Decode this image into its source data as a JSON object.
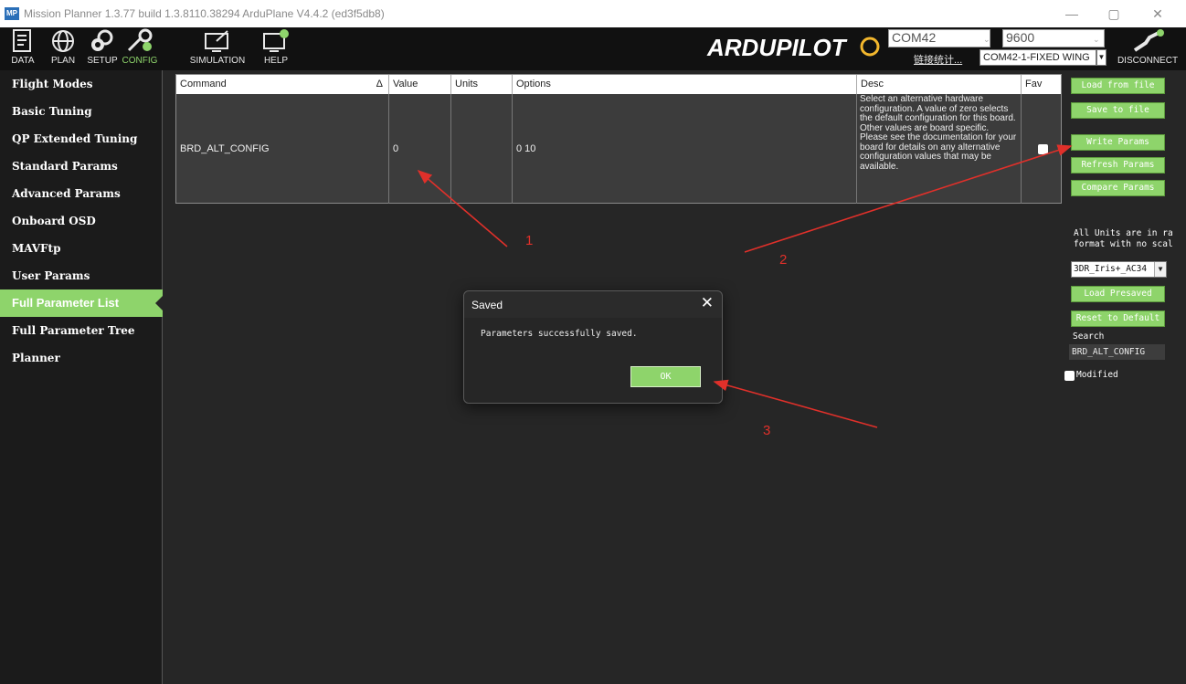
{
  "window": {
    "title": "Mission Planner 1.3.77 build 1.3.8110.38294 ArduPlane V4.4.2 (ed3f5db8)",
    "logo_text": "MP",
    "minimize": "—",
    "maximize": "▢",
    "close": "✕"
  },
  "toolbar": {
    "items": [
      {
        "label": "DATA",
        "icon": "data-icon"
      },
      {
        "label": "PLAN",
        "icon": "globe-icon"
      },
      {
        "label": "SETUP",
        "icon": "setup-gear-icon"
      },
      {
        "label": "CONFIG",
        "icon": "wrench-icon"
      },
      {
        "label": "SIMULATION",
        "icon": "simulation-icon"
      },
      {
        "label": "HELP",
        "icon": "help-icon"
      }
    ],
    "brand": "ARDUPILOT",
    "port": "COM42",
    "baud": "9600",
    "link_stats": "链接统计...",
    "vehicle": "COM42-1-FIXED WING",
    "disconnect": "DISCONNECT",
    "accent": "#8ed46b"
  },
  "sidebar": {
    "items": [
      {
        "label": "Flight Modes",
        "active": false
      },
      {
        "label": "Basic Tuning",
        "active": false
      },
      {
        "label": "QP Extended Tuning",
        "active": false
      },
      {
        "label": "Standard Params",
        "active": false
      },
      {
        "label": "Advanced Params",
        "active": false
      },
      {
        "label": "Onboard OSD",
        "active": false
      },
      {
        "label": "MAVFtp",
        "active": false
      },
      {
        "label": "User Params",
        "active": false
      },
      {
        "label": "Full Parameter List",
        "active": true
      },
      {
        "label": "Full Parameter Tree",
        "active": false
      },
      {
        "label": "Planner",
        "active": false
      }
    ]
  },
  "table": {
    "headers": {
      "command": "Command",
      "sort_indicator": "Δ",
      "value": "Value",
      "units": "Units",
      "options": "Options",
      "desc": "Desc",
      "fav": "Fav"
    },
    "rows": [
      {
        "command": "BRD_ALT_CONFIG",
        "value": "0",
        "units": "",
        "options": "0 10",
        "desc": "Select an alternative hardware configuration. A value of zero selects the default configuration for this board. Other values are board specific. Please see the documentation for your board for details on any alternative configuration values that may be available.",
        "fav": false
      }
    ]
  },
  "right_panel": {
    "load_from_file": "Load from file",
    "save_to_file": "Save to file",
    "write_params": "Write Params",
    "refresh_params": "Refresh Params",
    "compare_params": "Compare Params",
    "units_note_1": "All Units are in ra",
    "units_note_2": "format with no scal",
    "preset": "3DR_Iris+_AC34",
    "load_presaved": "Load Presaved",
    "reset_default": "Reset to Default",
    "search_label": "Search",
    "search_value": "BRD_ALT_CONFIG",
    "modified_label": "Modified"
  },
  "dialog": {
    "title": "Saved",
    "close": "✕",
    "message": "Parameters successfully saved.",
    "ok": "OK"
  },
  "annotations": {
    "one": "1",
    "two": "2",
    "three": "3",
    "color": "#e0302a"
  }
}
